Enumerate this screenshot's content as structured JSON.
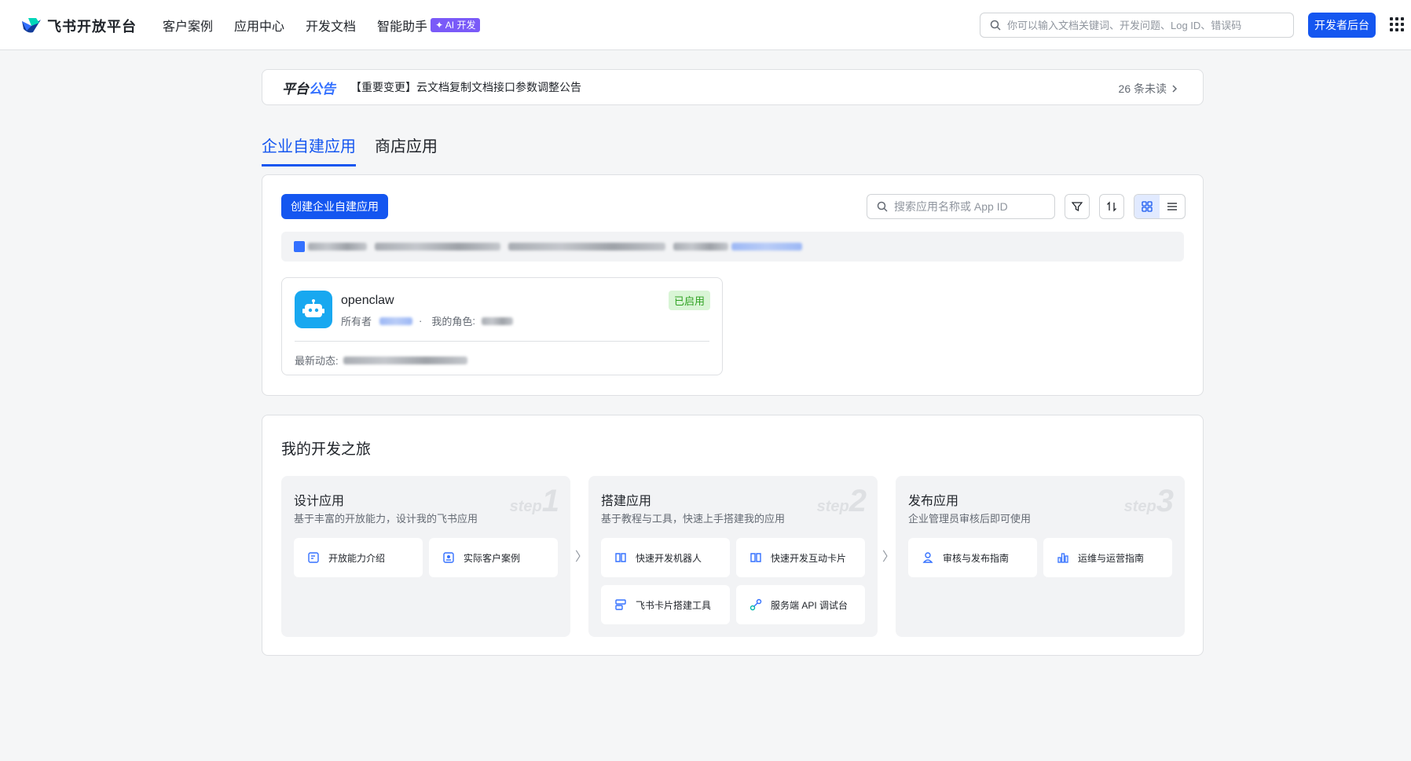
{
  "header": {
    "logo_text": "飞书开放平台",
    "nav": [
      {
        "label": "客户案例"
      },
      {
        "label": "应用中心"
      },
      {
        "label": "开发文档"
      },
      {
        "label": "智能助手",
        "badge": "✦ AI 开发"
      }
    ],
    "search_placeholder": "你可以输入文档关键词、开发问题、Log ID、错误码",
    "dev_button": "开发者后台"
  },
  "announcement": {
    "title_a": "平台",
    "title_b": "公告",
    "text": "【重要变更】云文档复制文档接口参数调整公告",
    "unread": "26 条未读"
  },
  "tabs": [
    {
      "label": "企业自建应用",
      "active": true
    },
    {
      "label": "商店应用",
      "active": false
    }
  ],
  "apps": {
    "create_button": "创建企业自建应用",
    "search_placeholder": "搜索应用名称或 App ID",
    "items": [
      {
        "name": "openclaw",
        "owner_label": "所有者",
        "role_label": "我的角色",
        "status": "已启用",
        "activity_label": "最新动态:"
      }
    ]
  },
  "journey": {
    "title": "我的开发之旅",
    "steps": [
      {
        "name": "设计应用",
        "desc": "基于丰富的开放能力，设计我的飞书应用",
        "tag": "step",
        "num": "1",
        "links": [
          "开放能力介绍",
          "实际客户案例"
        ]
      },
      {
        "name": "搭建应用",
        "desc": "基于教程与工具，快速上手搭建我的应用",
        "tag": "step",
        "num": "2",
        "links": [
          "快速开发机器人",
          "快速开发互动卡片",
          "飞书卡片搭建工具",
          "服务端 API 调试台"
        ]
      },
      {
        "name": "发布应用",
        "desc": "企业管理员审核后即可使用",
        "tag": "step",
        "num": "3",
        "links": [
          "审核与发布指南",
          "运维与运营指南"
        ]
      }
    ]
  },
  "colors": {
    "primary": "#1456f0",
    "status_green": "#2ea121",
    "ai_badge": "#7a5af8"
  }
}
